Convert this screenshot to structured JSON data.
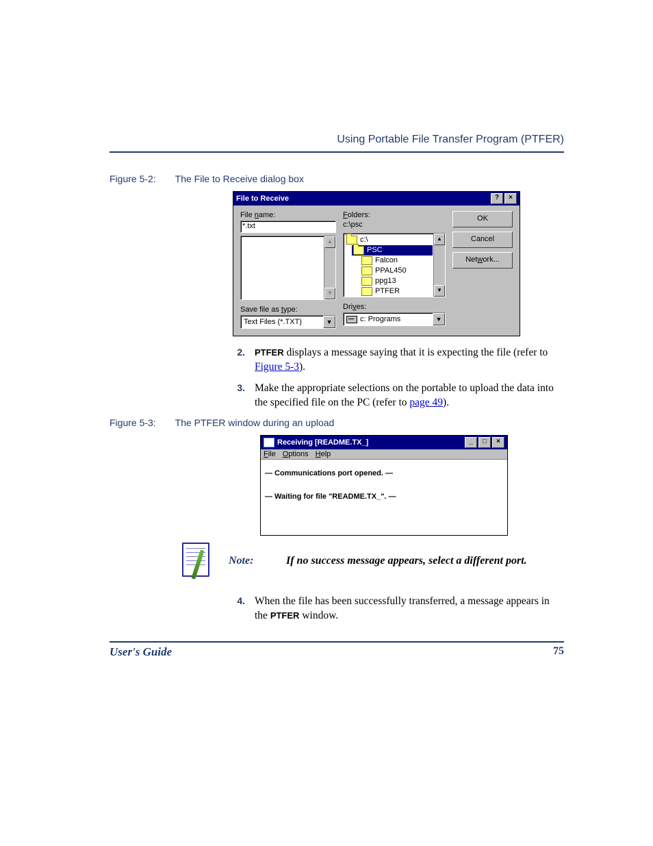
{
  "header": {
    "section_title": "Using Portable File Transfer Program (PTFER)"
  },
  "figure1": {
    "label": "Figure 5-2:",
    "caption": "The File to Receive dialog box",
    "dialog": {
      "title": "File to Receive",
      "filename_label": "File name:",
      "filename_accesskey": "n",
      "filename_value": "*.txt",
      "folders_label": "Folders:",
      "folders_accesskey": "F",
      "folders_path": "c:\\psc",
      "folder_tree": {
        "root": "c:\\",
        "selected": "PSC",
        "children": [
          "Falcon",
          "PPAL450",
          "ppg13",
          "PTFER"
        ]
      },
      "save_as_label": "Save file as type:",
      "save_as_accesskey": "t",
      "save_as_value": "Text Files (*.TXT)",
      "drives_label": "Drives:",
      "drives_accesskey": "v",
      "drives_value": "c: Programs",
      "buttons": {
        "ok": "OK",
        "cancel": "Cancel",
        "network": "Network...",
        "network_accesskey": "w"
      }
    }
  },
  "steps": {
    "s2": {
      "num": "2.",
      "kw": "PTFER",
      "text_a": " displays a message saying that it is expecting the file (refer to ",
      "link": "Figure 5-3",
      "text_b": ")."
    },
    "s3": {
      "num": "3.",
      "text_a": "Make the appropriate selections on the portable to upload the data into the specified file on the PC (refer to ",
      "link": "page 49",
      "text_b": ")."
    },
    "s4": {
      "num": "4.",
      "text_a": "When the file has been successfully transferred, a message appears in the ",
      "kw": "PTFER",
      "text_b": " window."
    }
  },
  "figure2": {
    "label": "Figure 5-3:",
    "caption": "The PTFER window during an upload",
    "window": {
      "title": "Receiving [README.TX_]",
      "menu": {
        "file": "File",
        "file_key": "F",
        "options": "Options",
        "options_key": "O",
        "help": "Help",
        "help_key": "H"
      },
      "line1": "— Communications port opened. —",
      "line2": "— Waiting for file \"README.TX_\". —"
    }
  },
  "note": {
    "label": "Note:",
    "text": "If no success message appears, select a different port."
  },
  "footer": {
    "left": "User's Guide",
    "page": "75"
  }
}
